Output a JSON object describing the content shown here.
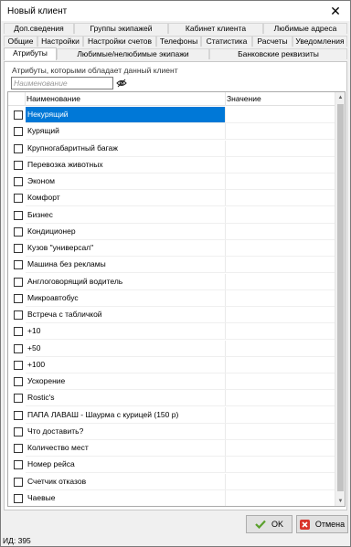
{
  "window": {
    "title": "Новый клиент"
  },
  "tabs": {
    "row1": [
      "Доп.сведения",
      "Группы экипажей",
      "Кабинет клиента",
      "Любимые адреса"
    ],
    "row2": [
      "Общие",
      "Настройки",
      "Настройки счетов",
      "Телефоны",
      "Статистика",
      "Расчеты",
      "Уведомления"
    ],
    "row3": [
      "Атрибуты",
      "Любимые/нелюбимые экипажи",
      "Банковские реквизиты"
    ],
    "active": "Атрибуты"
  },
  "attributes": {
    "group_label": "Атрибуты, которыми обладает данный клиент",
    "filter_placeholder": "Наименование",
    "columns": {
      "name": "Наименование",
      "value": "Значение"
    },
    "items": [
      "Некурящий",
      "Курящий",
      "Крупногабаритный багаж",
      "Перевозка животных",
      "Эконом",
      "Комфорт",
      "Бизнес",
      "Кондиционер",
      "Кузов \"универсал\"",
      "Машина без рекламы",
      "Англоговорящий водитель",
      "Микроавтобус",
      "Встреча с табличкой",
      "+10",
      "+50",
      "+100",
      "Ускорение",
      "Rostic's",
      "ПАПА ЛАВАШ - Шаурма с курицей (150 р)",
      "Что доставить?",
      "Количество мест",
      "Номер рейса",
      "Счетчик отказов",
      "Чаевые"
    ],
    "selected_index": 0
  },
  "buttons": {
    "ok": "OK",
    "cancel": "Отмена"
  },
  "status": {
    "id_text": "ИД: 395"
  },
  "colors": {
    "selection": "#0078d7",
    "ok_check": "#5aa02c",
    "cancel_x": "#d9342b"
  }
}
